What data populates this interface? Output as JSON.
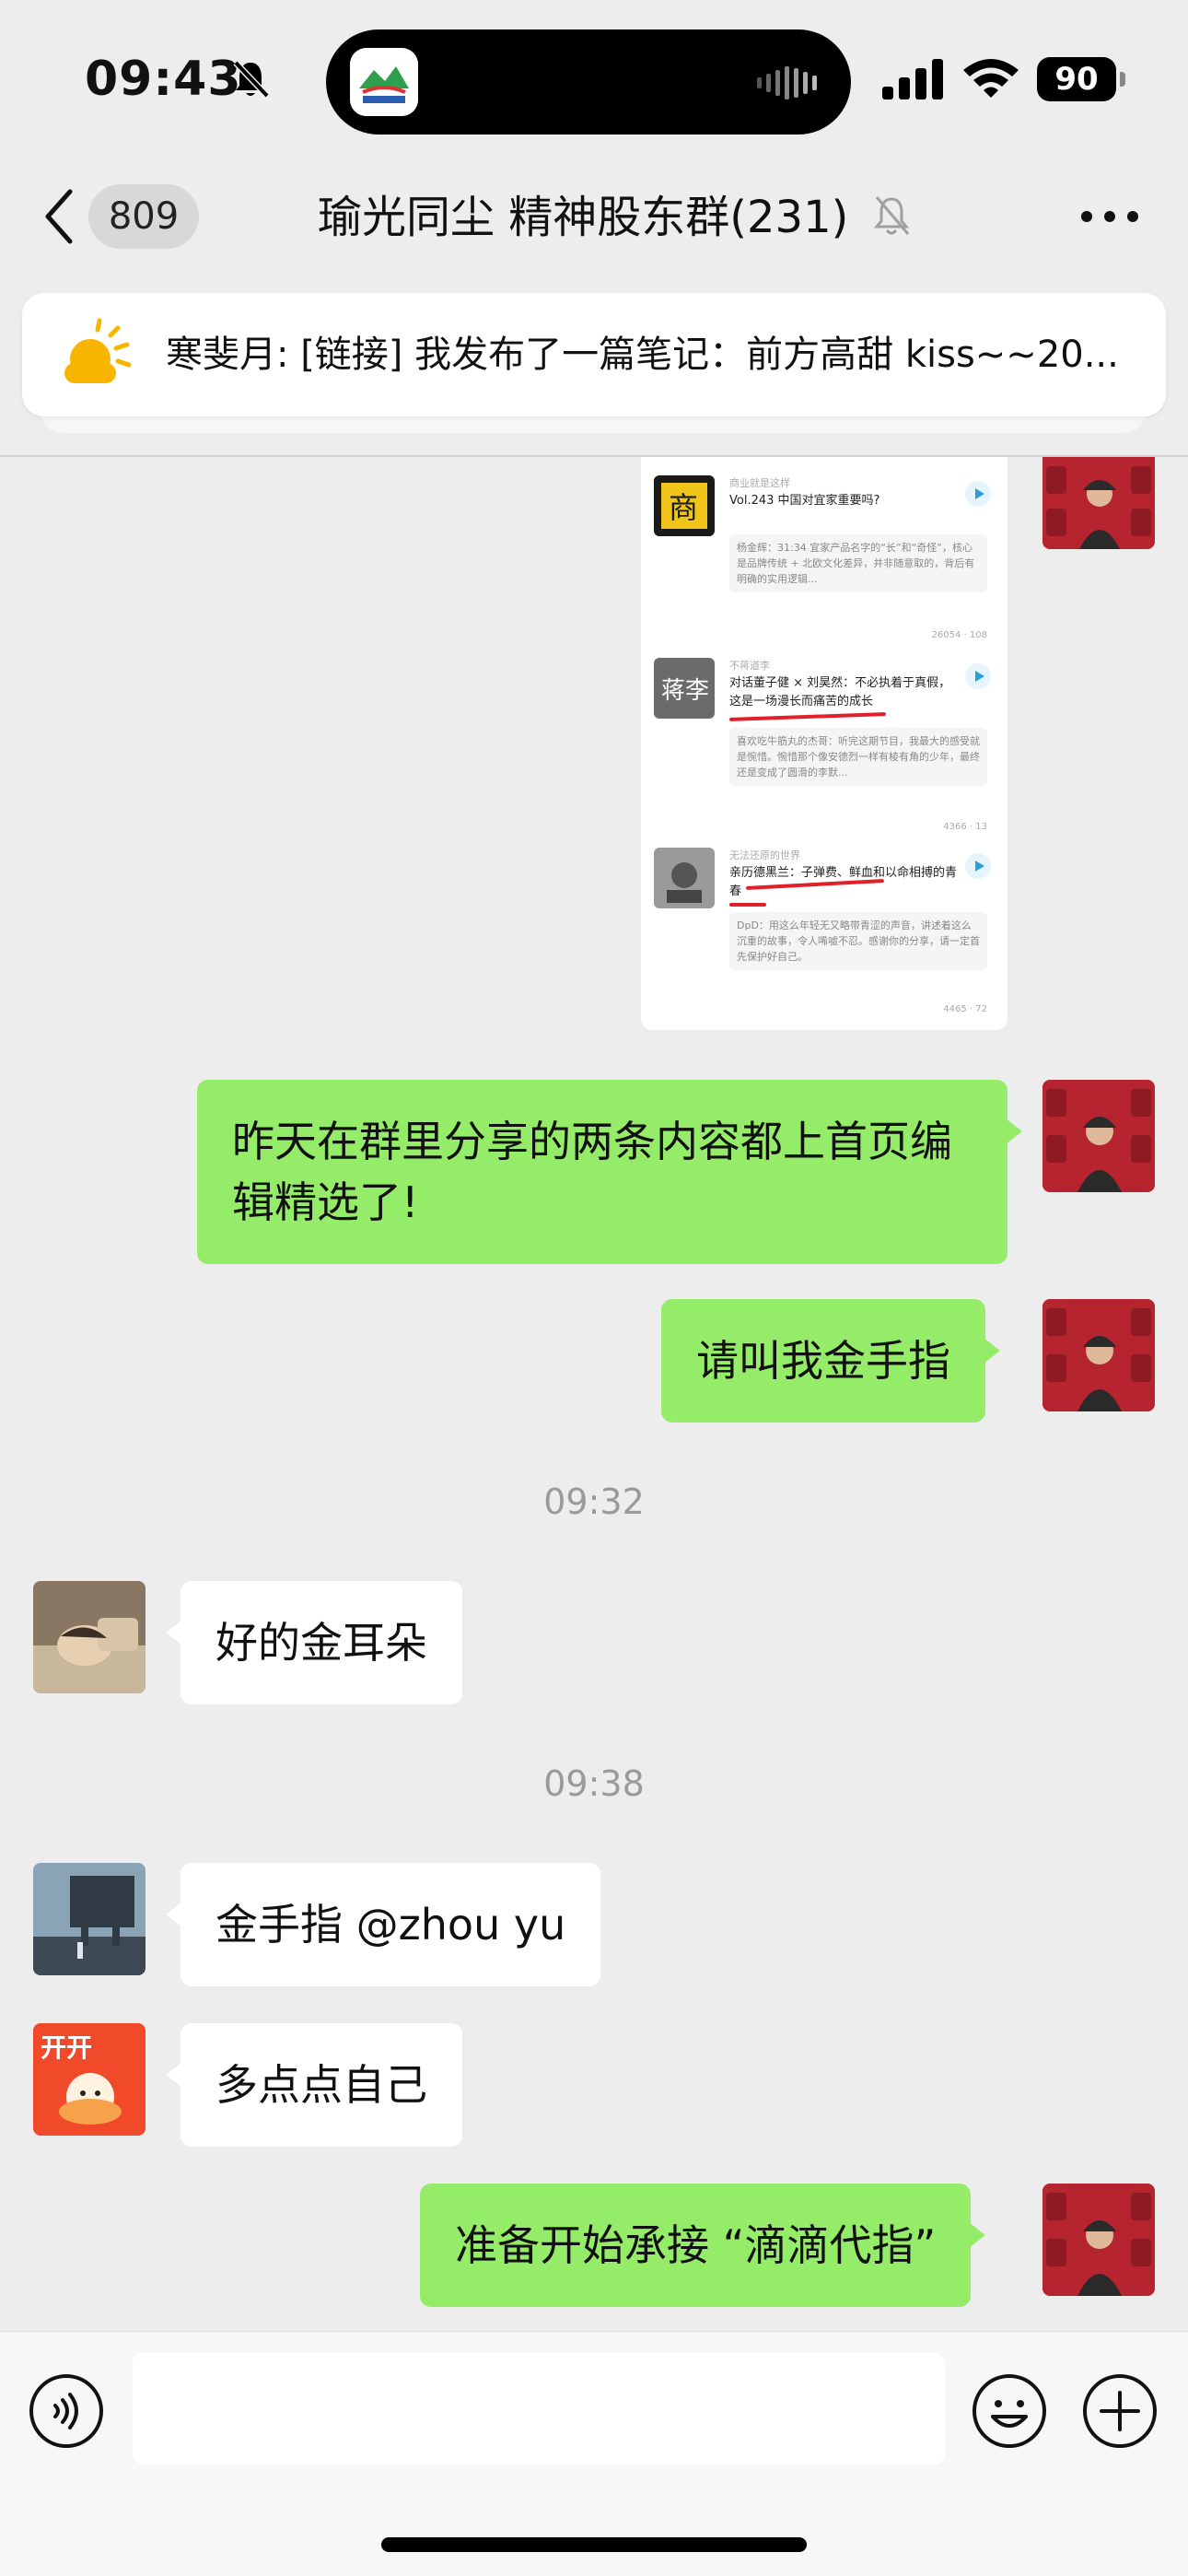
{
  "status_bar": {
    "time": "09:43",
    "battery": "90"
  },
  "nav": {
    "unread_count": "809",
    "title": "瑜光同尘 精神股东群(231)"
  },
  "notice": {
    "text": "寒斐月: [链接] 我发布了一篇笔记：前方高甜 kiss~~20..."
  },
  "shared_screenshot": {
    "items": [
      {
        "source": "商业就是这样",
        "title": "Vol.243 中国对宜家重要吗?",
        "comment": "杨金辉：31:34 宜家产品名字的“长”和“奇怪”，核心是品牌传统 + 北欧文化差异，并非随意取的，背后有明确的实用逻辑...",
        "meta": "26054 · 108"
      },
      {
        "source": "不蒋道李",
        "title": "对话董子健 × 刘昊然：不必执着于真假，这是一场漫长而痛苦的成长",
        "comment": "喜欢吃牛筋丸的杰哥：听完这期节目，我最大的感受就是惋惜。惋惜那个像安德烈一样有棱有角的少年，最终还是变成了圆滑的李默...",
        "meta": "4366 · 13"
      },
      {
        "source": "无法还原的世界",
        "title": "亲历德黑兰：子弹费、鲜血和以命相搏的青春",
        "comment": "DpD：用这么年轻无又略带青涩的声音，讲述着这么沉重的故事，令人唏嘘不忍。感谢你的分享，请一定首先保护好自己。",
        "meta": "4465 · 72"
      }
    ]
  },
  "messages": {
    "m1": "昨天在群里分享的两条内容都上首页编辑精选了!",
    "m2": "请叫我金手指",
    "ts1": "09:32",
    "m3": "好的金耳朵",
    "ts2": "09:38",
    "m4": "金手指 @zhou yu",
    "m5": "多点点自己",
    "m6": "准备开始承接 “滴滴代指”"
  },
  "input": {
    "placeholder": ""
  },
  "colors": {
    "my_bubble": "#95ec69",
    "their_bubble": "#ffffff",
    "background": "#ededed"
  }
}
